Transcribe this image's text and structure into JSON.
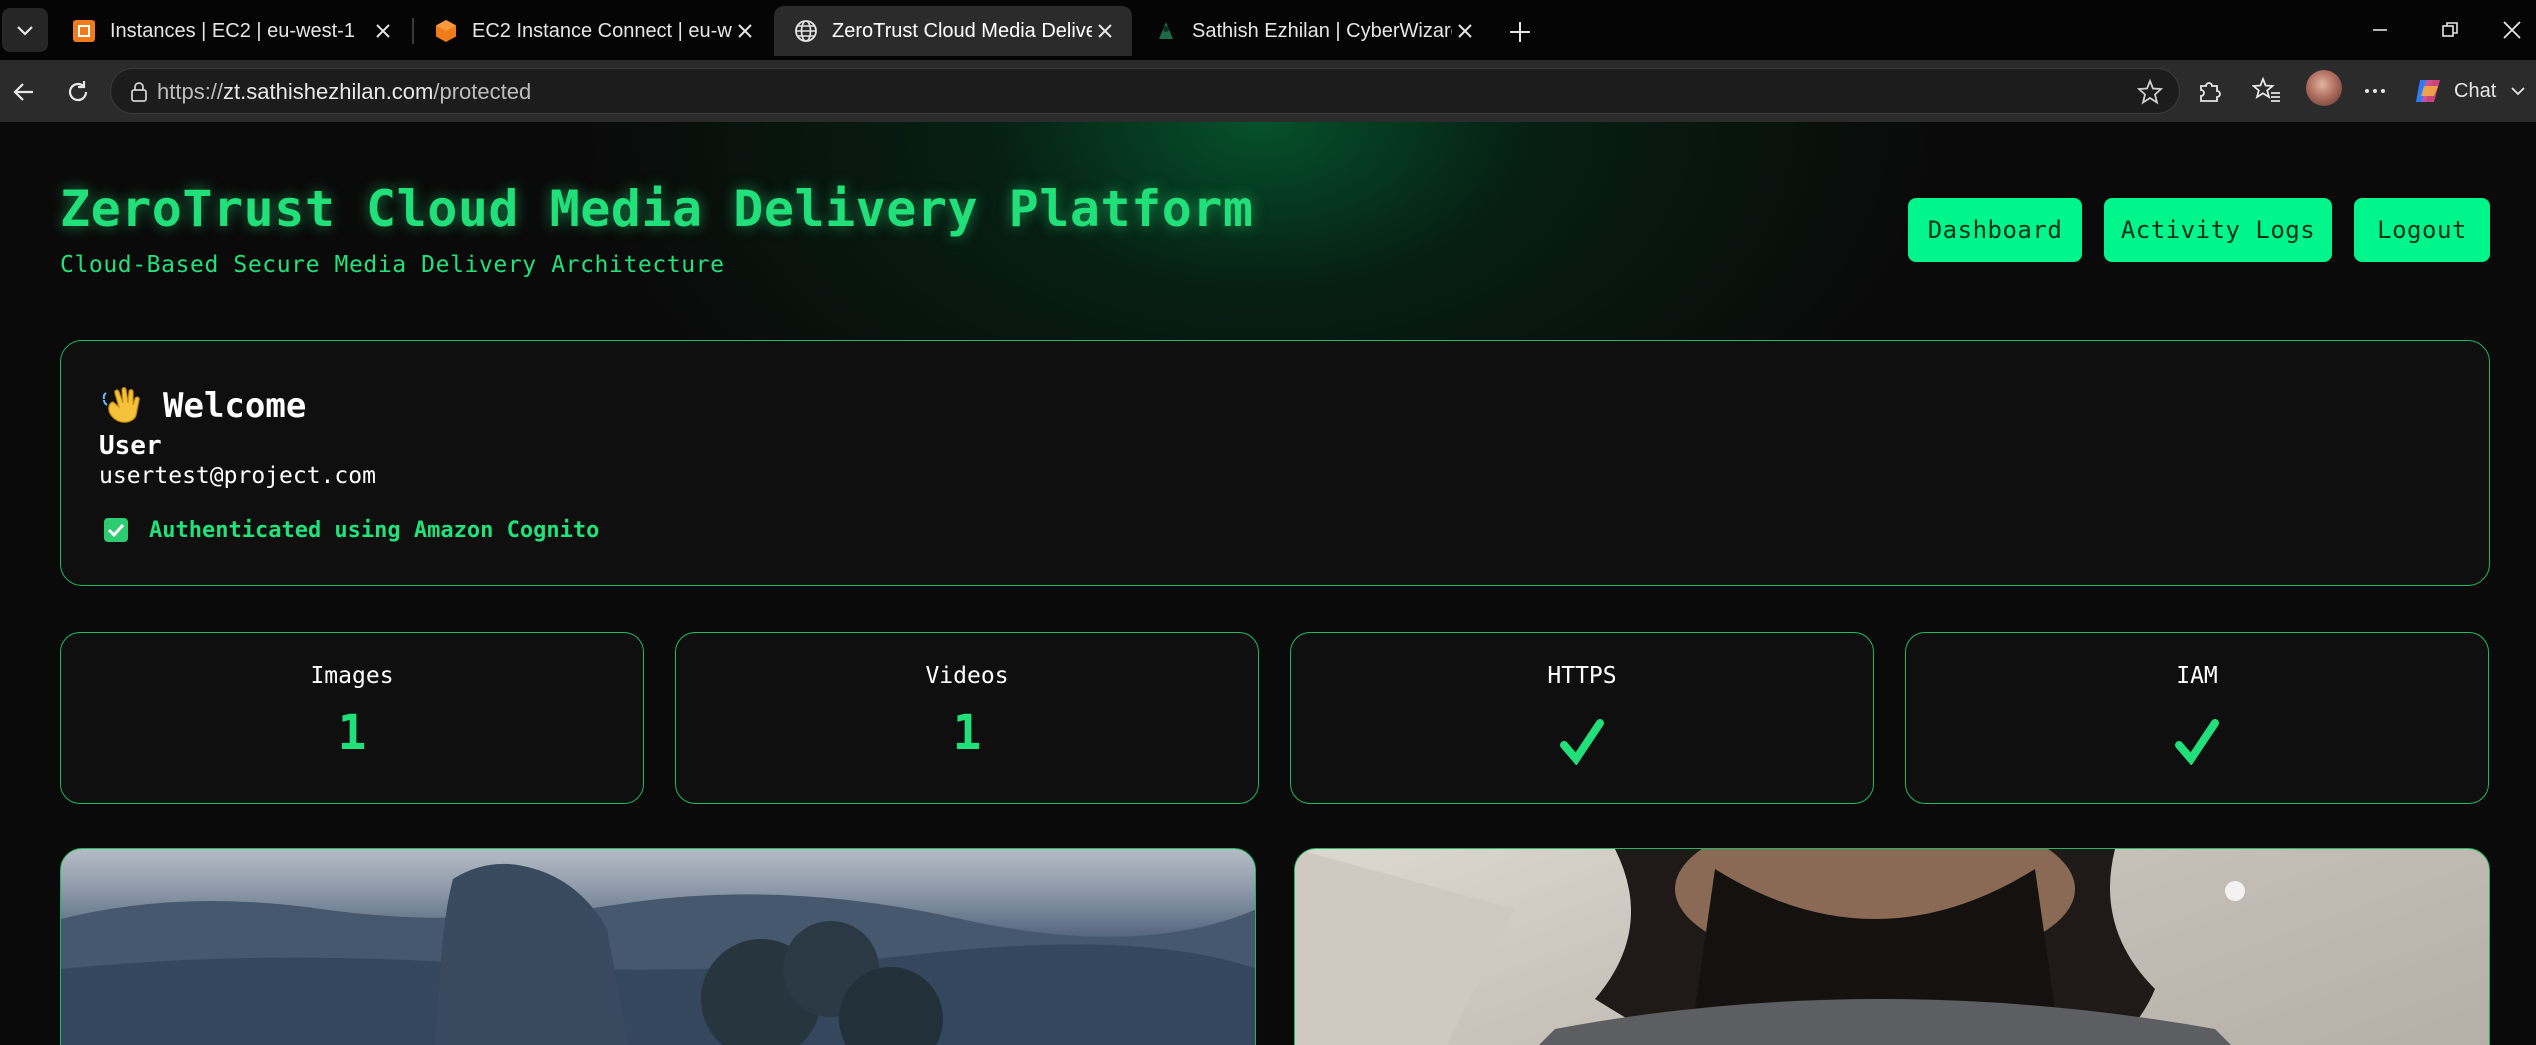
{
  "browser": {
    "tabs": [
      {
        "title": "Instances | EC2 | eu-west-1",
        "icon": "aws-ec2-icon",
        "active": false
      },
      {
        "title": "EC2 Instance Connect | eu-west-1",
        "icon": "aws-ec2-connect-icon",
        "active": false
      },
      {
        "title": "ZeroTrust Cloud Media Delivery Pl",
        "icon": "globe-icon",
        "active": true
      },
      {
        "title": "Sathish Ezhilan | CyberWizard",
        "icon": "site-icon",
        "active": false
      }
    ],
    "url_prefix": "https://",
    "url_host": "zt.sathishezhilan.com",
    "url_path": "/protected",
    "copilot_label": "Chat"
  },
  "header": {
    "title": "ZeroTrust Cloud Media Delivery Platform",
    "subtitle": "Cloud-Based Secure Media Delivery Architecture",
    "nav": {
      "dashboard": "Dashboard",
      "activity_logs": "Activity Logs",
      "logout": "Logout"
    }
  },
  "welcome": {
    "heading": "Welcome",
    "user_name": "User",
    "email": "usertest@project.com",
    "auth_status": "Authenticated using Amazon Cognito"
  },
  "stats": [
    {
      "label": "Images",
      "value": "1"
    },
    {
      "label": "Videos",
      "value": "1"
    },
    {
      "label": "HTTPS",
      "value": "✓"
    },
    {
      "label": "IAM",
      "value": "✓"
    }
  ],
  "colors": {
    "accent": "#21e07a",
    "button_bg": "#00f58a",
    "card_border": "#1fb865",
    "background": "#0a0a0a"
  }
}
